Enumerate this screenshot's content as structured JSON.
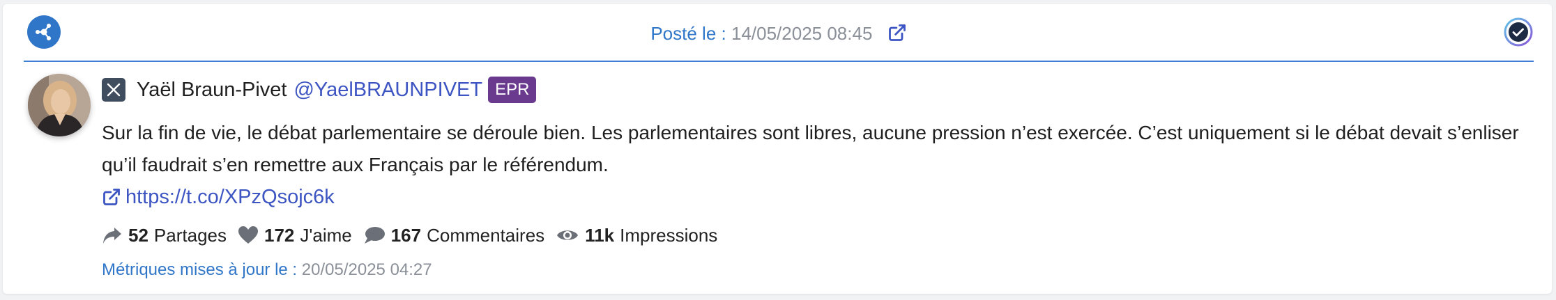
{
  "header": {
    "posted_label": "Posté le :",
    "posted_value": "14/05/2025 08:45"
  },
  "icons": {
    "network": "network-hub-icon",
    "external": "external-link-icon",
    "status": "verified-check-icon",
    "platform": "x-logo-icon"
  },
  "colors": {
    "accent": "#3076c8",
    "link": "#3d55c2",
    "party_badge": "#6a3a8e",
    "muted": "#8a8f98"
  },
  "post": {
    "author_name": "Yaël Braun-Pivet",
    "handle": "@YaelBRAUNPIVET",
    "party": "EPR",
    "text": "Sur la fin de vie, le débat parlementaire se déroule bien. Les parlementaires sont libres, aucune pression n’est exercée. C’est uniquement si le débat devait s’enliser qu’il faudrait s’en remettre aux Français par le référendum.",
    "link": "https://t.co/XPzQsojc6k"
  },
  "metrics": {
    "shares_value": "52",
    "shares_label": "Partages",
    "likes_value": "172",
    "likes_label": "J'aime",
    "comments_value": "167",
    "comments_label": "Commentaires",
    "impressions_value": "11k",
    "impressions_label": "Impressions"
  },
  "footer": {
    "updated_label": "Métriques mises à jour le :",
    "updated_value": "20/05/2025 04:27"
  }
}
